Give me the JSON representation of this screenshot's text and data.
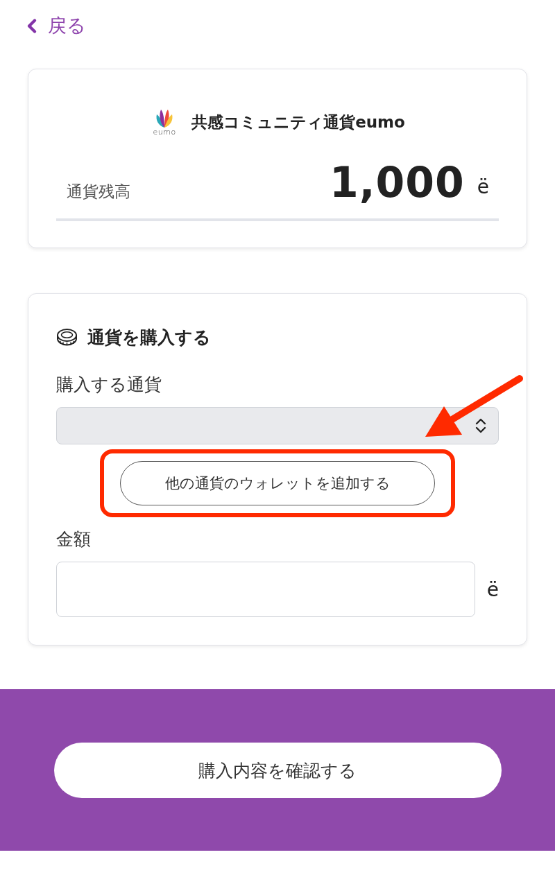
{
  "back_link": {
    "label": "戻る"
  },
  "balance_card": {
    "logo_text": "eumo",
    "currency_name": "共感コミュニティ通貨eumo",
    "balance_label": "通貨残高",
    "balance": "1,000",
    "unit": "ë"
  },
  "purchase_card": {
    "title": "通貨を購入する",
    "currency_label": "購入する通貨",
    "add_wallet_button": {
      "label": "他の通貨のウォレットを追加する",
      "highlighted": true
    },
    "amount_label": "金額",
    "amount_unit": "ë"
  },
  "footer": {
    "confirm_button": "購入内容を確認する"
  },
  "annotations": [
    {
      "kind": "arrow"
    }
  ]
}
